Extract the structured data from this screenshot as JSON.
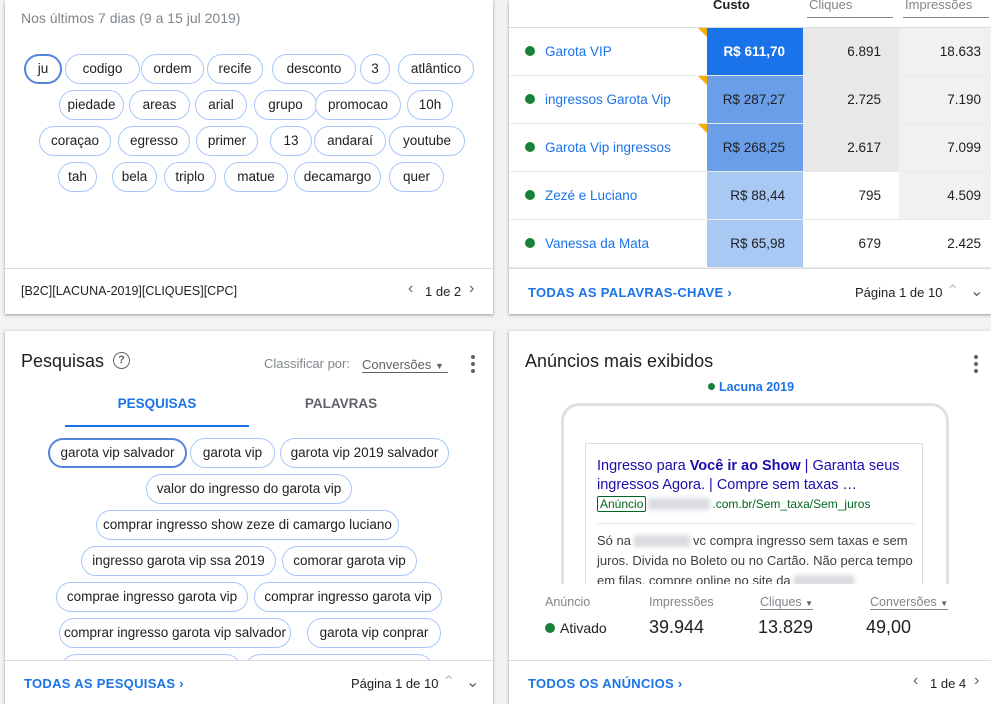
{
  "top_left": {
    "date_range": "Nos últimos 7 dias (9 a 15 jul 2019)",
    "words": [
      "ju",
      "codigo",
      "ordem",
      "recife",
      "desconto",
      "3",
      "atlântico",
      "piedade",
      "areas",
      "arial",
      "grupo",
      "promocao",
      "10h",
      "coraçao",
      "egresso",
      "primer",
      "13",
      "andaraí",
      "youtube",
      "tah",
      "bela",
      "triplo",
      "matue",
      "decamargo",
      "quer"
    ],
    "footer_label": "[B2C][LACUNA-2019][CLIQUES][CPC]",
    "pager": "1 de 2"
  },
  "top_right": {
    "headers": [
      "Custo",
      "Cliques",
      "Impressões"
    ],
    "rows": [
      {
        "keyword": "Garota VIP",
        "cost": "R$ 611,70",
        "clicks": "6.891",
        "impressions": "18.633"
      },
      {
        "keyword": "ingressos Garota Vip",
        "cost": "R$ 287,27",
        "clicks": "2.725",
        "impressions": "7.190"
      },
      {
        "keyword": "Garota Vip ingressos",
        "cost": "R$ 268,25",
        "clicks": "2.617",
        "impressions": "7.099"
      },
      {
        "keyword": "Zezé e Luciano",
        "cost": "R$ 88,44",
        "clicks": "795",
        "impressions": "4.509"
      },
      {
        "keyword": "Vanessa da Mata",
        "cost": "R$ 65,98",
        "clicks": "679",
        "impressions": "2.425"
      }
    ],
    "colors": {
      "cost_heat": [
        "#1a73e8",
        "#6a9ee8",
        "#6a9ee8",
        "#a9c9f5",
        "#a9c9f5"
      ],
      "clicks_bg": "#e8e8e8",
      "impressions_bg": "#f1f1f1",
      "status_dot": "#188038",
      "flag": "#f9ab00"
    },
    "all_link": "TODAS AS PALAVRAS-CHAVE",
    "pager": "Página 1 de 10"
  },
  "bottom_left": {
    "title": "Pesquisas",
    "sort_label": "Classificar por:",
    "sort_value": "Conversões",
    "tabs": [
      "PESQUISAS",
      "PALAVRAS"
    ],
    "chips": [
      "garota vip salvador",
      "garota vip",
      "garota vip 2019 salvador",
      "valor do ingresso do garota vip",
      "comprar ingresso show zeze di camargo luciano",
      "ingresso garota vip ssa 2019",
      "comorar garota vip",
      "comprae ingresso garota vip",
      "comprar ingresso garota vip",
      "comprar ingresso garota vip salvador",
      "garota vip conprar"
    ],
    "all_link": "TODAS AS PESQUISAS",
    "pager": "Página 1 de 10"
  },
  "bottom_right": {
    "title": "Anúncios mais exibidos",
    "campaign": "Lacuna 2019",
    "ad": {
      "headline_1": "Ingresso para ",
      "headline_bold": "Você ir ao Show",
      "headline_2": " | Garanta seus ingressos Agora. | Compre sem taxas …",
      "badge": "Anúncio",
      "url": ".com.br/Sem_taxa/Sem_juros",
      "desc_1": "Só na",
      "desc_2": "vc compra ingresso sem taxas e sem juros. Divida no Boleto ou no Cartão. Não perca tempo em filas, compre online no site da"
    },
    "stats_headers": [
      "Anúncio",
      "Impressões",
      "Cliques",
      "Conversões"
    ],
    "status": "Ativado",
    "impressions": "39.944",
    "clicks": "13.829",
    "conversions": "49,00",
    "all_link": "TODOS OS ANÚNCIOS",
    "pager": "1 de 4"
  },
  "icons": [
    "help-icon",
    "chevron-left-icon",
    "chevron-right-icon",
    "chevron-up-icon",
    "chevron-down-icon",
    "more-vert-icon",
    "dropdown-arrow-icon"
  ]
}
